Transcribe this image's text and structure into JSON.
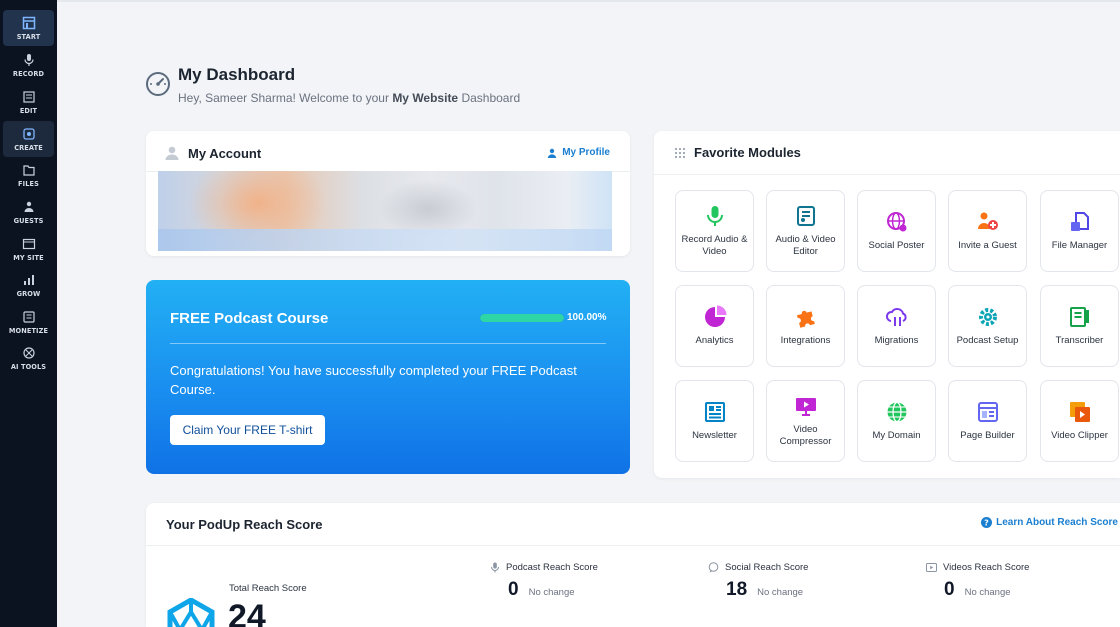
{
  "sidebar": {
    "items": [
      {
        "label": "START",
        "icon": "start-icon"
      },
      {
        "label": "RECORD",
        "icon": "microphone-icon"
      },
      {
        "label": "EDIT",
        "icon": "edit-icon"
      },
      {
        "label": "CREATE",
        "icon": "create-icon"
      },
      {
        "label": "FILES",
        "icon": "files-icon"
      },
      {
        "label": "GUESTS",
        "icon": "guests-icon"
      },
      {
        "label": "MY SITE",
        "icon": "my-site-icon"
      },
      {
        "label": "GROW",
        "icon": "grow-icon"
      },
      {
        "label": "MONETIZE",
        "icon": "monetize-icon"
      },
      {
        "label": "AI TOOLS",
        "icon": "ai-tools-icon"
      }
    ]
  },
  "header": {
    "title": "My Dashboard",
    "greeting_prefix": "Hey, Sameer Sharma! Welcome to your ",
    "site_name": "My Website",
    "greeting_suffix": " Dashboard"
  },
  "account": {
    "title": "My Account",
    "profile_link": "My Profile"
  },
  "course": {
    "title": "FREE Podcast Course",
    "progress_percent": 100,
    "progress_label": "100.00%",
    "message": "Congratulations! You have successfully completed your FREE Podcast Course.",
    "button_label": "Claim Your FREE T-shirt"
  },
  "favorites": {
    "title": "Favorite Modules",
    "modules": [
      {
        "label": "Record Audio & Video",
        "icon": "microphone-icon",
        "color": "#22c55e"
      },
      {
        "label": "Audio & Video Editor",
        "icon": "audio-video-editor-icon",
        "color": "#0e7490"
      },
      {
        "label": "Social Poster",
        "icon": "social-poster-icon",
        "color": "#c026d3"
      },
      {
        "label": "Invite a Guest",
        "icon": "invite-guest-icon",
        "color": "#f97316"
      },
      {
        "label": "File Manager",
        "icon": "file-manager-icon",
        "color": "#4f46e5"
      },
      {
        "label": "Analytics",
        "icon": "analytics-icon",
        "color": "#c026d3"
      },
      {
        "label": "Integrations",
        "icon": "integrations-icon",
        "color": "#f97316"
      },
      {
        "label": "Migrations",
        "icon": "migrations-icon",
        "color": "#7c3aed"
      },
      {
        "label": "Podcast Setup",
        "icon": "podcast-setup-icon",
        "color": "#0ea5b7"
      },
      {
        "label": "Transcriber",
        "icon": "transcriber-icon",
        "color": "#16a34a"
      },
      {
        "label": "Newsletter",
        "icon": "newsletter-icon",
        "color": "#0284c7"
      },
      {
        "label": "Video Compressor",
        "icon": "video-compressor-icon",
        "color": "#c026d3"
      },
      {
        "label": "My Domain",
        "icon": "my-domain-icon",
        "color": "#16a34a"
      },
      {
        "label": "Page Builder",
        "icon": "page-builder-icon",
        "color": "#6366f1"
      },
      {
        "label": "Video Clipper",
        "icon": "video-clipper-icon",
        "color": "#ea580c"
      }
    ]
  },
  "reach": {
    "title": "Your PodUp Reach Score",
    "learn_link": "Learn About Reach Score",
    "total_label": "Total Reach Score",
    "total_value": "24",
    "podcast": {
      "label": "Podcast Reach Score",
      "value": "0",
      "change": "No change"
    },
    "social": {
      "label": "Social Reach Score",
      "value": "18",
      "change": "No change"
    },
    "videos": {
      "label": "Videos Reach Score",
      "value": "0",
      "change": "No change"
    }
  },
  "colors": {
    "sidebar_bg": "#0b1320",
    "accent_blue": "#1a7fd0",
    "course_gradient_top": "#22b0f4",
    "course_gradient_bottom": "#0f72e6",
    "progress_green": "#2dd6a4"
  }
}
